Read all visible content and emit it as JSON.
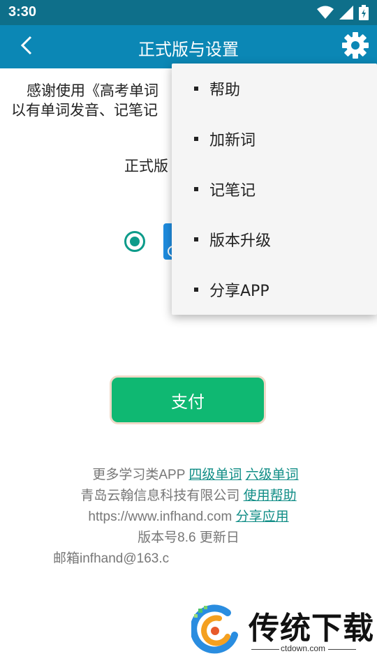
{
  "status_bar": {
    "time": "3:30",
    "icons": [
      "wifi-icon",
      "signal-icon",
      "battery-icon"
    ]
  },
  "app_bar": {
    "title": "正式版与设置",
    "back_icon": "chevron-left-icon",
    "settings_icon": "gear-icon"
  },
  "main": {
    "intro_line1": "感谢使用《高考单词",
    "intro_line2": "以有单词发音、记笔记",
    "version_label": "正式版",
    "pay_button": "支付"
  },
  "footer": {
    "line1_text": "更多学习类APP",
    "line1_link1": "四级单词",
    "line1_link2": "六级单词",
    "line2_text": "青岛云翰信息科技有限公司",
    "line2_link": "使用帮助",
    "line3_text": "https://www.infhand.com",
    "line3_link": "分享应用",
    "line4_text": "版本号8.6 更新日",
    "line5_text": "邮箱infhand@163.c"
  },
  "menu": {
    "items": [
      {
        "label": "帮助"
      },
      {
        "label": "加新词"
      },
      {
        "label": "记笔记"
      },
      {
        "label": "版本升级"
      },
      {
        "label": "分享APP"
      }
    ]
  },
  "watermark": {
    "brand": "传统下载",
    "url": "ctdown.com"
  },
  "colors": {
    "status_bar": "#0e6f8a",
    "app_bar": "#0b87b5",
    "accent_teal": "#0c9b8a",
    "pay_button": "#0fb872",
    "link": "#108d86"
  }
}
